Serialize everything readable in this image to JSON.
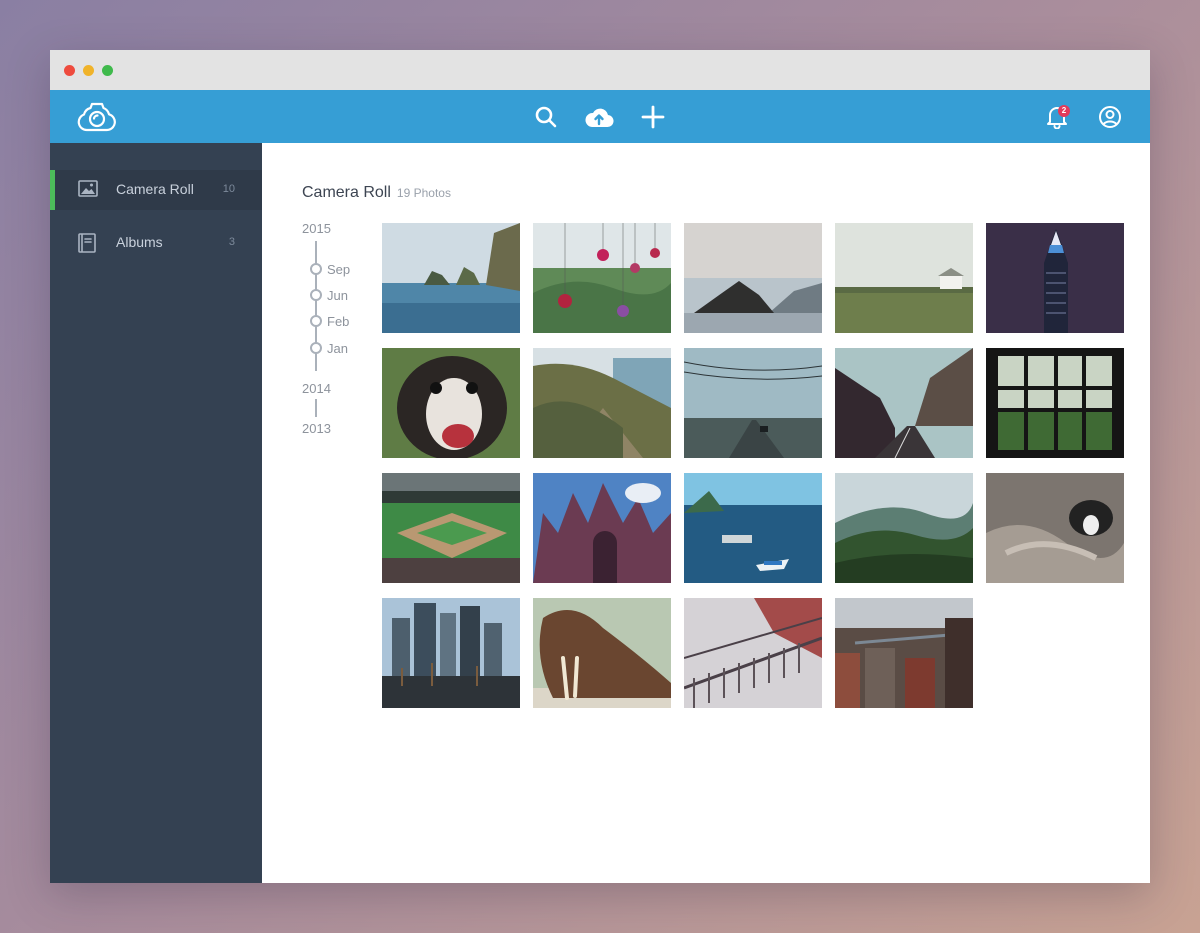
{
  "window": {
    "controls": [
      "close",
      "minimize",
      "maximize"
    ]
  },
  "header": {
    "logo_icon": "camera-cloud-icon",
    "tools": [
      "search-icon",
      "upload-cloud-icon",
      "plus-icon"
    ],
    "notifications_count": "2",
    "colors": {
      "bar": "#369ed5",
      "badge": "#e23b5b"
    }
  },
  "sidebar": {
    "items": [
      {
        "icon": "image-icon",
        "label": "Camera Roll",
        "count": "10",
        "active": true
      },
      {
        "icon": "album-icon",
        "label": "Albums",
        "count": "3",
        "active": false
      }
    ],
    "colors": {
      "background": "#344152",
      "active_marker": "#4cbb5a"
    }
  },
  "main": {
    "title": "Camera Roll",
    "subtitle": "19 Photos",
    "timeline": {
      "years": [
        "2015",
        "2014",
        "2013"
      ],
      "months": [
        "Sep",
        "Jun",
        "Feb",
        "Jan"
      ]
    },
    "photos": [
      "sea-cliffs",
      "hanging-ornaments",
      "mountain-lake",
      "barn-field",
      "empire-state-night",
      "dog-closeup",
      "coastal-cliffs",
      "highway-powerlines",
      "mountain-road",
      "window-greenery",
      "baseball-stadium",
      "gothic-cathedral",
      "boats-bay",
      "green-mountains",
      "sleeping-dog",
      "city-skyline-harbor",
      "walrus",
      "iron-fence",
      "city-rooftops"
    ]
  }
}
